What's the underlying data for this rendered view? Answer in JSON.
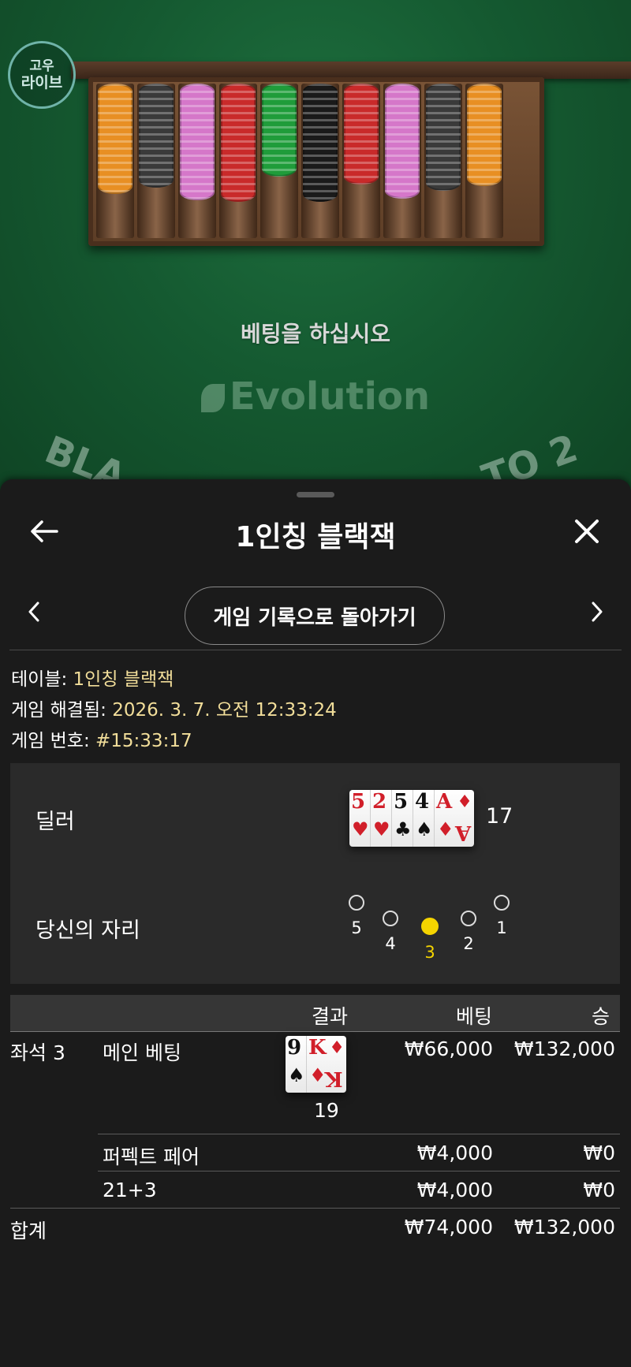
{
  "background": {
    "logo_line1": "고우",
    "logo_line2": "라이브",
    "place_bets": "베팅을 하십시오",
    "brand": "Evolution",
    "arc_left": "BLA",
    "arc_right": "TO 2",
    "chip_colors": [
      "#e88f23",
      "#3a3a3a",
      "#d577c9",
      "#c92a2a",
      "#1f9c3a",
      "#1a1a1a",
      "#c92a2a",
      "#d577c9",
      "#3a3a3a",
      "#e88f23"
    ]
  },
  "sheet": {
    "title": "1인칭 블랙잭",
    "history_button": "게임 기록으로 돌아가기",
    "info": {
      "table_label": "테이블:",
      "table_value": "1인칭 블랙잭",
      "resolved_label": "게임 해결됨:",
      "resolved_value": "2026. 3. 7. 오전 12:33:24",
      "game_no_label": "게임 번호:",
      "game_no_value": "#15:33:17"
    },
    "dealer": {
      "label": "딜러",
      "cards": [
        {
          "rank": "5",
          "suit": "♥",
          "color": "red"
        },
        {
          "rank": "2",
          "suit": "♥",
          "color": "red"
        },
        {
          "rank": "5",
          "suit": "♣",
          "color": "black"
        },
        {
          "rank": "4",
          "suit": "♠",
          "color": "black"
        },
        {
          "rank": "A",
          "suit": "♦",
          "color": "red"
        }
      ],
      "total": "17"
    },
    "seats": {
      "label": "당신의 자리",
      "numbers": [
        "5",
        "4",
        "3",
        "2",
        "1"
      ],
      "active": "3"
    },
    "table": {
      "headers": {
        "result": "결과",
        "bet": "베팅",
        "win": "승"
      },
      "seat_label": "좌석 3",
      "main": {
        "label": "메인 베팅",
        "cards": [
          {
            "rank": "9",
            "suit": "♠",
            "color": "black"
          },
          {
            "rank": "K",
            "suit": "♦",
            "color": "red"
          }
        ],
        "total": "19",
        "bet": "₩66,000",
        "win": "₩132,000"
      },
      "perfect_pair": {
        "label": "퍼펙트 페어",
        "bet": "₩4,000",
        "win": "₩0"
      },
      "side_213": {
        "label": "21+3",
        "bet": "₩4,000",
        "win": "₩0"
      },
      "total": {
        "label": "합계",
        "bet": "₩74,000",
        "win": "₩132,000"
      }
    }
  }
}
